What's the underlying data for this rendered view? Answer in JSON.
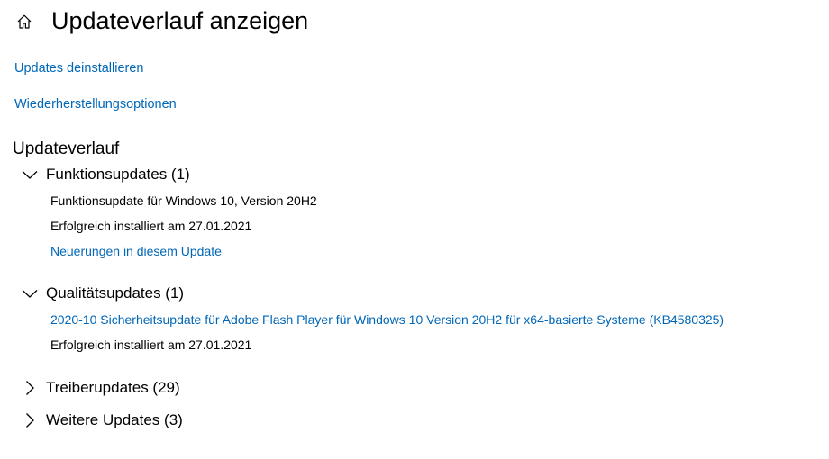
{
  "header": {
    "title": "Updateverlauf anzeigen",
    "home_icon": "home-icon"
  },
  "links": {
    "uninstall": "Updates deinstallieren",
    "recovery": "Wiederherstellungsoptionen"
  },
  "history": {
    "title": "Updateverlauf",
    "categories": [
      {
        "label": "Funktionsupdates (1)",
        "expanded": true,
        "items": [
          {
            "name": "Funktionsupdate für Windows 10, Version 20H2",
            "status": "Erfolgreich installiert am 27.01.2021",
            "link": "Neuerungen in diesem Update"
          }
        ]
      },
      {
        "label": "Qualitätsupdates (1)",
        "expanded": true,
        "items": [
          {
            "name": "2020-10 Sicherheitsupdate für Adobe Flash Player für Windows 10 Version 20H2 für x64-basierte Systeme (KB4580325)",
            "status": "Erfolgreich installiert am 27.01.2021"
          }
        ]
      },
      {
        "label": "Treiberupdates (29)",
        "expanded": false
      },
      {
        "label": "Weitere Updates (3)",
        "expanded": false
      }
    ]
  },
  "colors": {
    "link": "#0067b8",
    "text": "#000000",
    "background": "#ffffff"
  }
}
